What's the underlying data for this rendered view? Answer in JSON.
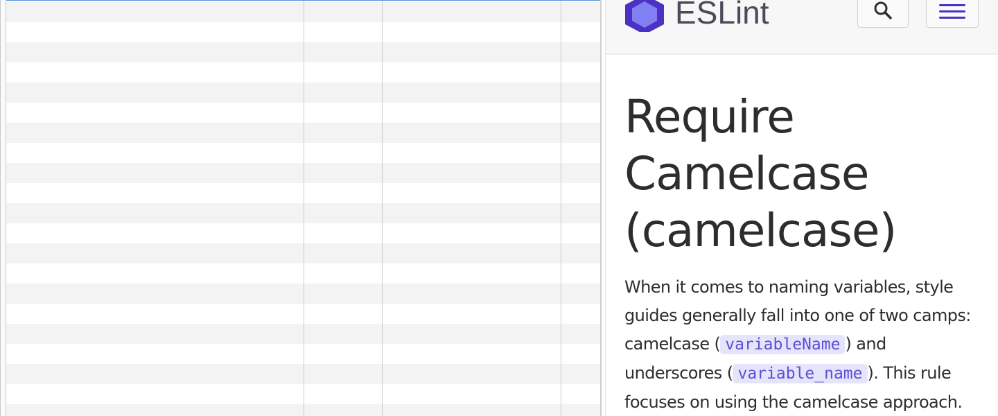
{
  "grid": {
    "row_count": 21,
    "column_count": 4
  },
  "header": {
    "logo_text": "ESLint",
    "logo_icon": "eslint-hexagon-logo",
    "search_icon": "search-icon",
    "menu_icon": "hamburger-menu-icon"
  },
  "article": {
    "title_line1": "Require",
    "title_line2": "Camelcase",
    "title_line3": "(camelcase)",
    "intro_part1": "When it comes to naming variables, style guides generally fall into one of two camps: camelcase (",
    "intro_code1": "variableName",
    "intro_part2": ") and underscores (",
    "intro_code2": "variable_name",
    "intro_part3": "). This rule focuses on using the camelcase approach."
  },
  "colors": {
    "accent": "#4b32c3",
    "code_bg": "#e6e4fb",
    "code_text": "#5b50d6",
    "row_alt": "#f3f3f3"
  }
}
